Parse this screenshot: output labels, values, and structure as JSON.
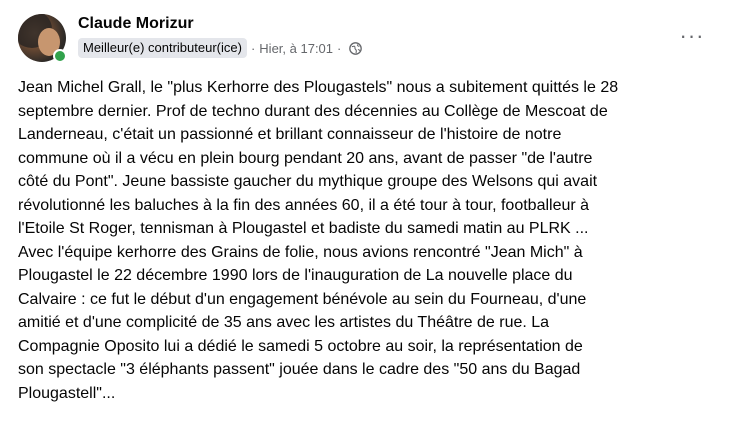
{
  "post": {
    "author": "Claude Morizur",
    "badge": "Meilleur(e) contributeur(ice)",
    "separator": "·",
    "timestamp": "Hier, à 17:01",
    "separator2": "·",
    "privacy_icon": "globe-icon",
    "more_icon": "more-options-icon",
    "more_label": "···",
    "body": "Jean Michel Grall, le \"plus Kerhorre des Plougastels\" nous a subitement quittés le 28\nseptembre dernier. Prof de techno durant des décennies au Collège de Mescoat de\nLanderneau, c'était un passionné et brillant connaisseur de l'histoire de notre\ncommune où il a vécu en  plein bourg pendant 20 ans, avant de passer \"de l'autre\ncôté du Pont\". Jeune bassiste gaucher du mythique groupe  des Welsons qui avait\nrévolutionné les baluches à la fin des années 60,  il a été tour à tour, footballeur à\nl'Etoile St Roger, tennisman à  Plougastel et badiste du samedi matin au PLRK ...\nAvec l'équipe kerhorre  des Grains de folie, nous avions rencontré \"Jean Mich\" à\nPlougastel le  22 décembre 1990 lors de l'inauguration de La nouvelle place du\nCalvaire  : ce fut le début d'un engagement bénévole au sein du Fourneau, d'une\namitié et d'une complicité de 35 ans avec les artistes du Théâtre de  rue. La\nCompagnie Oposito lui a dédié le samedi 5 octobre au soir, la  représentation de\nson spectacle \"3 éléphants passent\" jouée dans le  cadre des \"50 ans du Bagad\nPlougastell\"..."
  },
  "colors": {
    "online": "#31a24c",
    "badge_bg": "#e4e6eb",
    "muted_text": "#65676b",
    "text": "#050505"
  }
}
